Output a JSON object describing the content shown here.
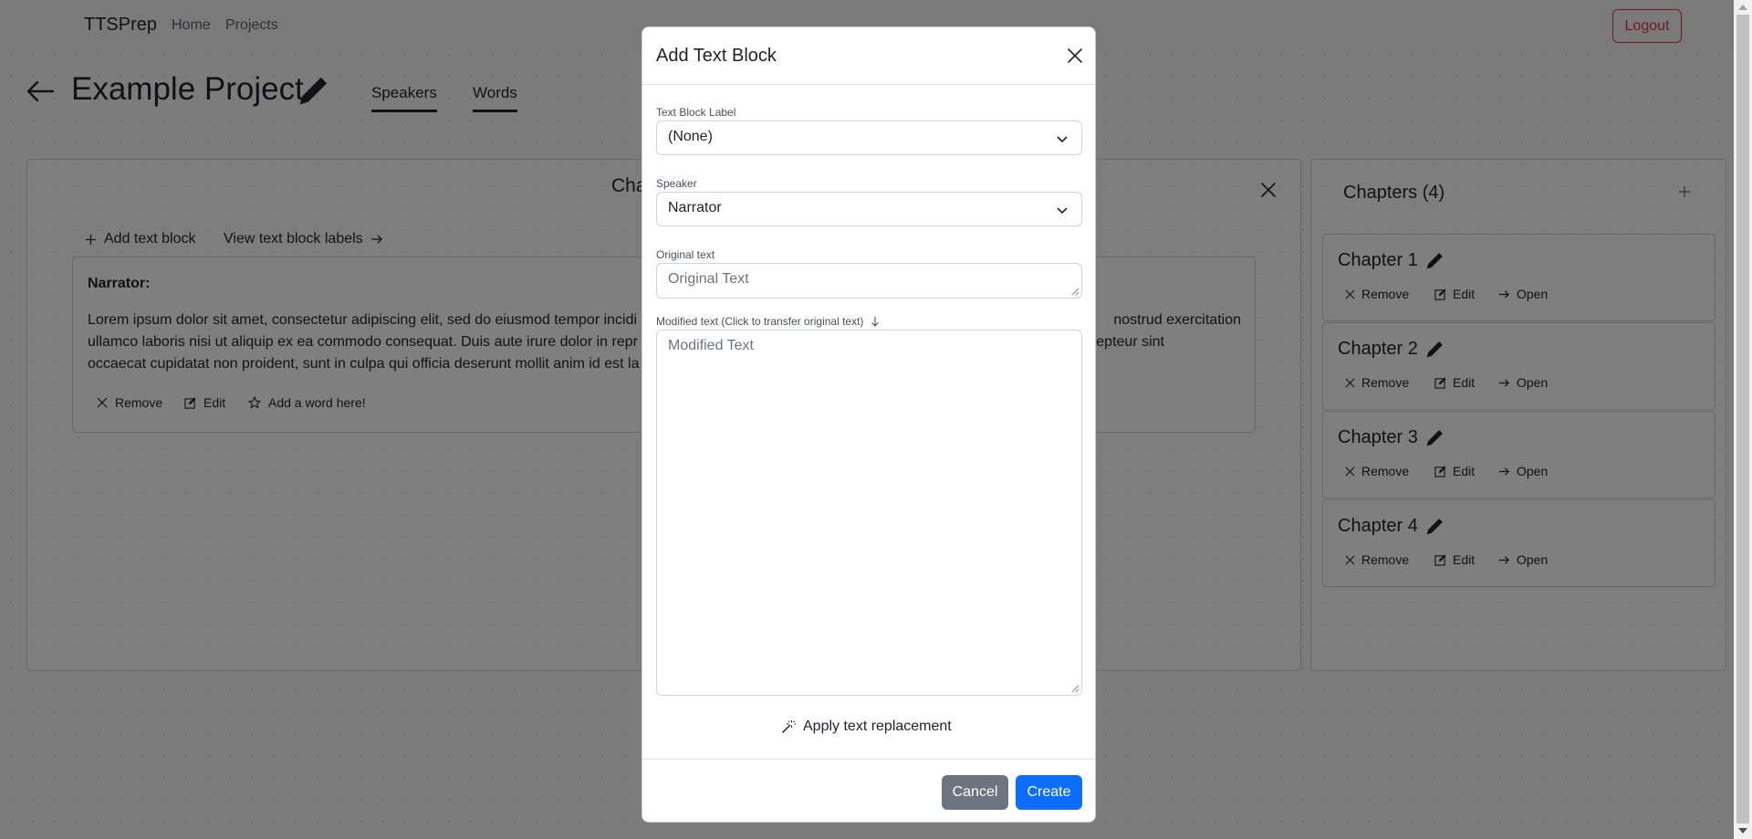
{
  "navbar": {
    "brand": "TTSPrep",
    "links": [
      "Home",
      "Projects"
    ],
    "logout": "Logout"
  },
  "project": {
    "title": "Example Project",
    "tabs": [
      "Speakers",
      "Words"
    ]
  },
  "main": {
    "panel_title": "Cha",
    "toolbar": {
      "add_text_block": "Add text block",
      "view_labels": "View text block labels"
    },
    "text_block": {
      "speaker": "Narrator:",
      "line1_left": "Lorem ipsum dolor sit amet, consectetur adipiscing elit, sed do eiusmod tempor incidi",
      "line1_right": "nostrud exercitation",
      "line2_left": "ullamco laboris nisi ut aliquip ex ea commodo consequat. Duis aute irure dolor in repr",
      "line2_right": "xcepteur sint",
      "line3_left": "occaecat cupidatat non proident, sunt in culpa qui officia deserunt mollit anim id est la",
      "actions": {
        "remove": "Remove",
        "edit": "Edit",
        "add_word": "Add a word here!"
      }
    }
  },
  "chapters": {
    "title": "Chapters (4)",
    "items": [
      {
        "name": "Chapter 1",
        "remove": "Remove",
        "edit": "Edit",
        "open": "Open"
      },
      {
        "name": "Chapter 2",
        "remove": "Remove",
        "edit": "Edit",
        "open": "Open"
      },
      {
        "name": "Chapter 3",
        "remove": "Remove",
        "edit": "Edit",
        "open": "Open"
      },
      {
        "name": "Chapter 4",
        "remove": "Remove",
        "edit": "Edit",
        "open": "Open"
      }
    ]
  },
  "modal": {
    "title": "Add Text Block",
    "label_field": {
      "label": "Text Block Label",
      "value": "(None)"
    },
    "speaker_field": {
      "label": "Speaker",
      "value": "Narrator"
    },
    "original_field": {
      "label": "Original text",
      "placeholder": "Original Text"
    },
    "modified_field": {
      "label": "Modified text (Click to transfer original text)",
      "placeholder": "Modified Text"
    },
    "apply_replacement": "Apply text replacement",
    "cancel": "Cancel",
    "create": "Create"
  },
  "colors": {
    "primary": "#0d6efd",
    "secondary": "#6c757d",
    "danger": "#dc3545"
  }
}
